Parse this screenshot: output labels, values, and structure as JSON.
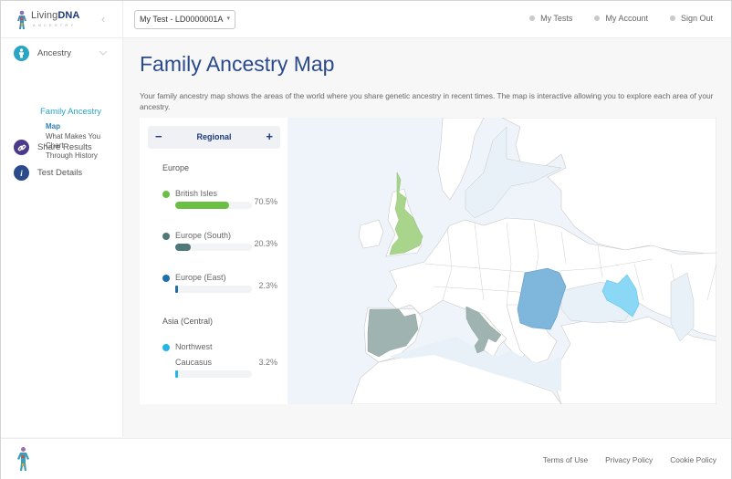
{
  "header": {
    "logo": {
      "brand_light": "Living",
      "brand_bold": "DNA",
      "tagline": "ANCESTRY"
    },
    "collapse_icon": "‹",
    "test_selector": {
      "value": "My Test - LD0000001A",
      "caret": "▾"
    },
    "nav": [
      {
        "label": "My Tests"
      },
      {
        "label": "My Account"
      },
      {
        "label": "Sign Out"
      }
    ]
  },
  "sidebar": {
    "items": [
      {
        "label": "Ancestry",
        "icon": "person-icon",
        "glyph": "♙",
        "color": "#2aa5c4"
      },
      {
        "label": "Share Results",
        "icon": "link-icon",
        "glyph": "⚭",
        "color": "#4b3a8c"
      },
      {
        "label": "Test Details",
        "icon": "info-icon",
        "glyph": "i",
        "color": "#2a4a8c"
      }
    ],
    "chevron": "⌄",
    "subsection": {
      "title": "Family Ancestry",
      "links": [
        {
          "label": "Map",
          "active": true
        },
        {
          "label": "What Makes You"
        },
        {
          "label": "Chart"
        },
        {
          "label": "Through History"
        }
      ]
    }
  },
  "main": {
    "title": "Family Ancestry Map",
    "description": "Your family ancestry map shows the areas of the world where you share genetic ancestry in recent times. The map is interactive allowing you to explore each area of your ancestry.",
    "level_control": {
      "label": "Regional",
      "minus": "−",
      "plus": "+"
    },
    "groups": [
      {
        "region": "Europe",
        "populations": [
          {
            "name": "British Isles",
            "percent_label": "70.5%",
            "percent": 70.5,
            "color": "#6cbf45"
          },
          {
            "name": "Europe (South)",
            "percent_label": "20.3%",
            "percent": 20.3,
            "color": "#4f7878"
          },
          {
            "name": "Europe (East)",
            "percent_label": "2.3%",
            "percent": 2.3,
            "color": "#1f6fa8"
          }
        ]
      },
      {
        "region": "Asia (Central)",
        "populations": [
          {
            "name_line1": "Northwest",
            "name_line2": "Caucasus",
            "percent_label": "3.2%",
            "percent": 3.2,
            "color": "#25b5e8"
          }
        ]
      }
    ],
    "map_colors": {
      "ocean": "#eef4f9",
      "sea": "#e8f1f8",
      "land": "#ffffff",
      "border": "#c9c9c9",
      "british_isles": "#a8d48c",
      "europe_south": "#9fb3b0",
      "europe_east": "#7fb6dc",
      "nw_caucasus": "#8ad8f5"
    }
  },
  "footer": {
    "links": [
      {
        "label": "Terms of Use"
      },
      {
        "label": "Privacy Policy"
      },
      {
        "label": "Cookie Policy"
      }
    ]
  }
}
